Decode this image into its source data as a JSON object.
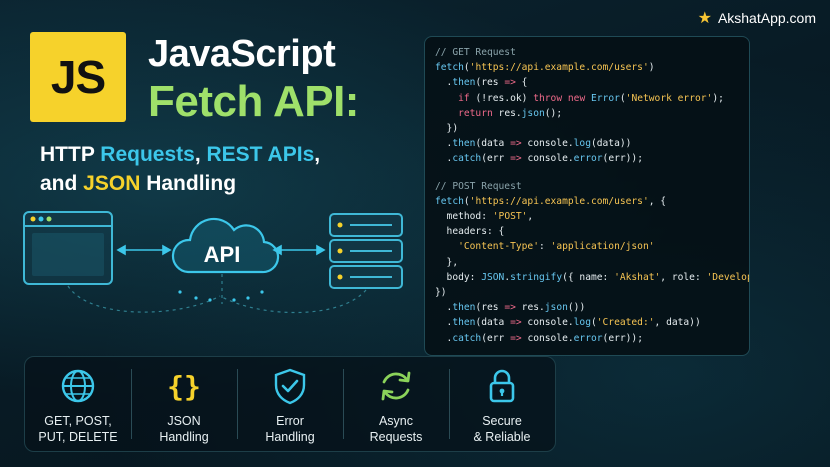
{
  "brand": {
    "text": "AkshatApp.com",
    "icon": "star-icon"
  },
  "logo": {
    "text": "JS"
  },
  "title": {
    "line1": "JavaScript",
    "line2": "Fetch API:"
  },
  "subtitle": {
    "l1_a": "HTTP ",
    "l1_b": "Requests",
    "l1_c": ", ",
    "l1_d": "REST APIs",
    "l1_e": ",",
    "l2_a": "and ",
    "l2_b": "JSON",
    "l2_c": " Handling"
  },
  "diagram": {
    "center_label": "API",
    "client_icon": "browser-window-icon",
    "server_icon": "server-stack-icon",
    "cloud_icon": "cloud-icon"
  },
  "code": {
    "get_comment": "// GET Request",
    "post_comment": "// POST Request"
  },
  "features": [
    {
      "icon": "globe-icon",
      "label_l1": "GET, POST,",
      "label_l2": "PUT, DELETE"
    },
    {
      "icon": "braces-icon",
      "label_l1": "JSON",
      "label_l2": "Handling"
    },
    {
      "icon": "shield-check-icon",
      "label_l1": "Error",
      "label_l2": "Handling"
    },
    {
      "icon": "refresh-icon",
      "label_l1": "Async",
      "label_l2": "Requests"
    },
    {
      "icon": "padlock-icon",
      "label_l1": "Secure",
      "label_l2": "& Reliable"
    }
  ],
  "colors": {
    "accent_green": "#9fe06a",
    "accent_cyan": "#3cc7ea",
    "js_yellow": "#f6d22b",
    "background": "#081b25"
  }
}
